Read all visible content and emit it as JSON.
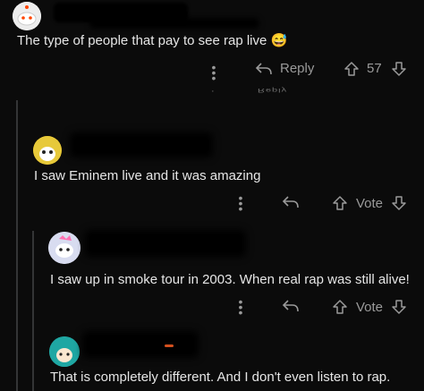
{
  "comment1": {
    "text": "The type of people that pay to see rap live",
    "emoji": "😅",
    "reply_label": "Reply",
    "vote_count": "57",
    "ghost_reply": "Reply"
  },
  "comment2": {
    "text": "I saw Eminem live and it was amazing",
    "vote_label": "Vote"
  },
  "comment3": {
    "text": "I saw up in smoke tour in 2003. When real rap was still alive!",
    "vote_label": "Vote"
  },
  "comment4": {
    "text": "That is completely different. And I don't even listen to rap."
  },
  "colors": {
    "background": "#0b0b0b",
    "text": "#e6e6e6",
    "muted": "#9a9a9a",
    "thread_line": "#343536"
  },
  "icons": [
    "more-icon",
    "reply-icon",
    "upvote-icon",
    "downvote-icon"
  ]
}
